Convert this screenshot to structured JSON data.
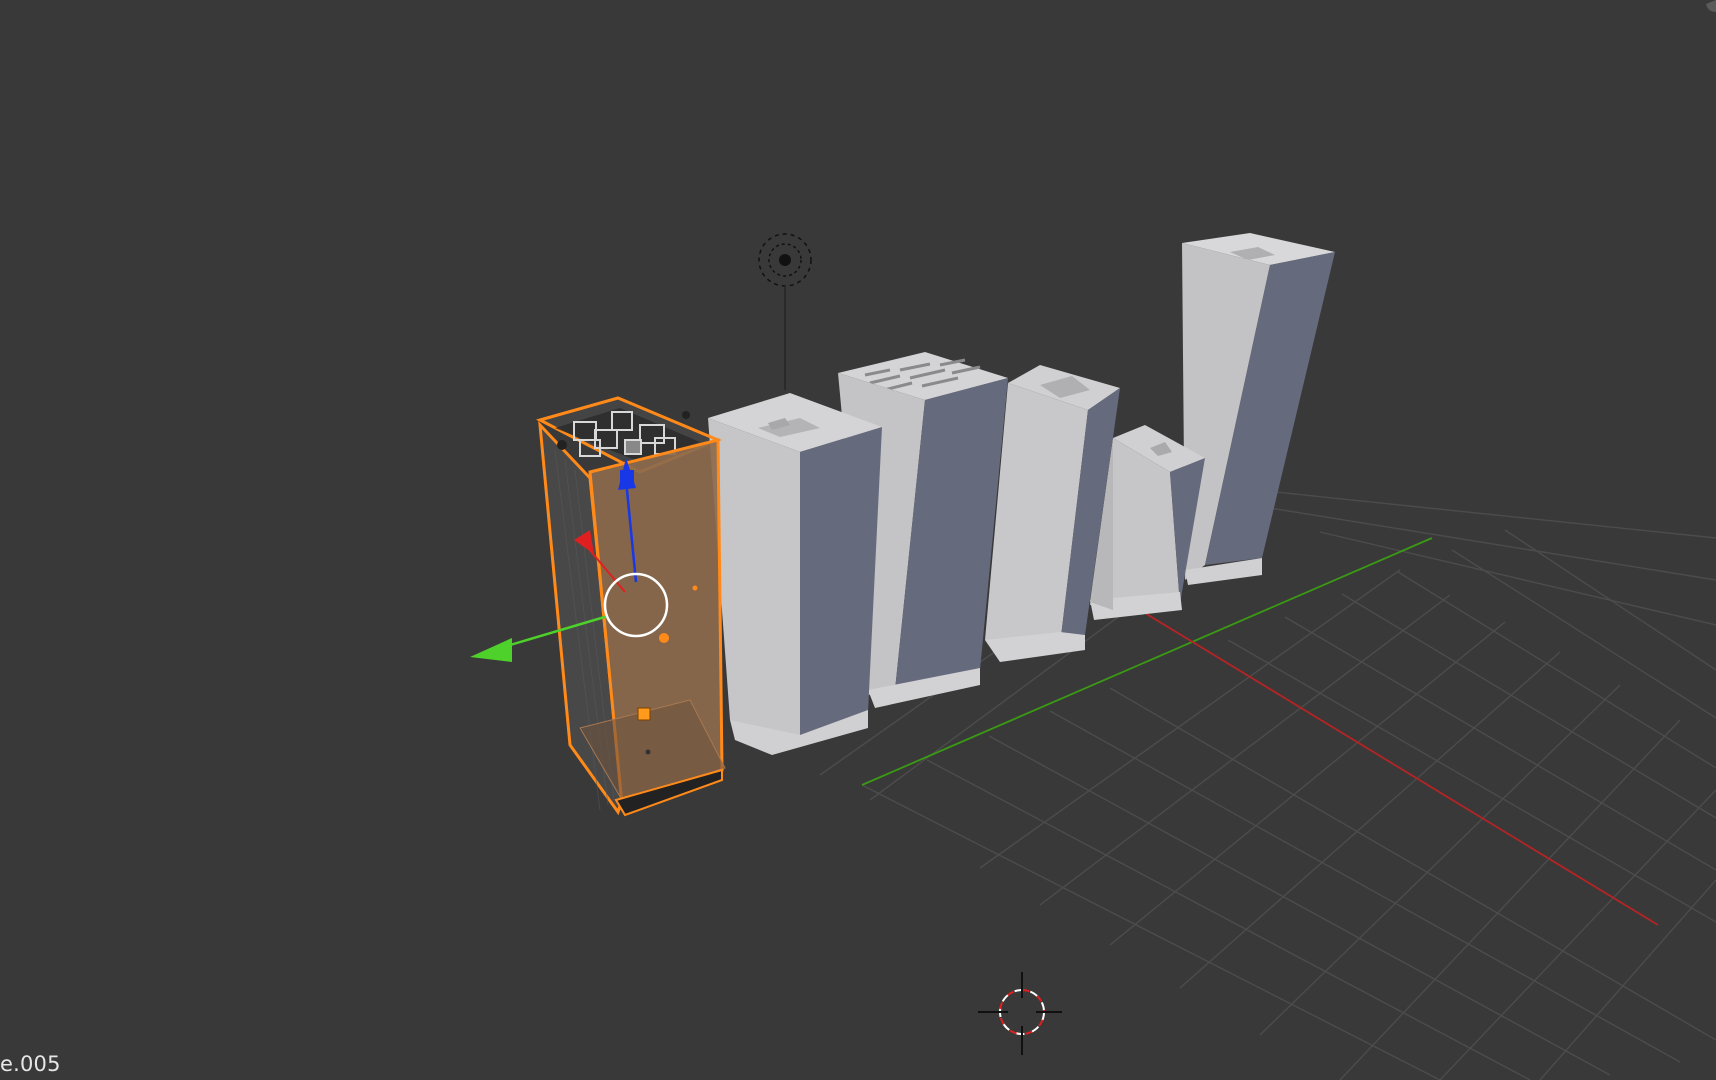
{
  "viewport": {
    "object_name_overlay": "e.005",
    "background_color": "#393939",
    "grid_line_color": "#4a4a4a",
    "x_axis_color": "#b52424",
    "y_axis_color": "#3a9a14"
  },
  "scene": {
    "selected_object": {
      "outline_color": "#ff8a1a",
      "fill_color": "#8c6a4c"
    },
    "manipulator": {
      "x_arrow_color": "#e02020",
      "y_arrow_color": "#4ed12a",
      "z_arrow_color": "#1838e8",
      "pivot_ring_color": "#ffffff"
    },
    "buildings_color": "#c4c4c6",
    "buildings_shadow_color": "#646878",
    "lamp_icon": "lamp-icon",
    "cursor_icon": "3d-cursor-icon"
  }
}
